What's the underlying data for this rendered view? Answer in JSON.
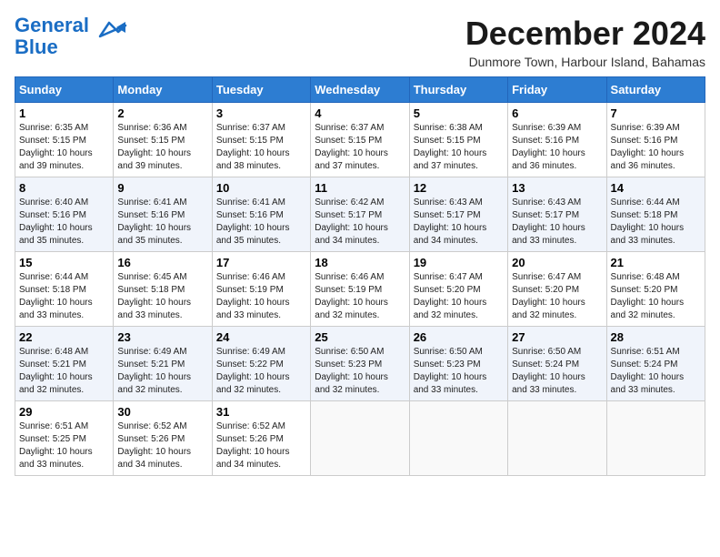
{
  "header": {
    "logo_line1": "General",
    "logo_line2": "Blue",
    "month_title": "December 2024",
    "subtitle": "Dunmore Town, Harbour Island, Bahamas"
  },
  "weekdays": [
    "Sunday",
    "Monday",
    "Tuesday",
    "Wednesday",
    "Thursday",
    "Friday",
    "Saturday"
  ],
  "weeks": [
    [
      {
        "day": "1",
        "sunrise": "6:35 AM",
        "sunset": "5:15 PM",
        "daylight": "10 hours and 39 minutes."
      },
      {
        "day": "2",
        "sunrise": "6:36 AM",
        "sunset": "5:15 PM",
        "daylight": "10 hours and 39 minutes."
      },
      {
        "day": "3",
        "sunrise": "6:37 AM",
        "sunset": "5:15 PM",
        "daylight": "10 hours and 38 minutes."
      },
      {
        "day": "4",
        "sunrise": "6:37 AM",
        "sunset": "5:15 PM",
        "daylight": "10 hours and 37 minutes."
      },
      {
        "day": "5",
        "sunrise": "6:38 AM",
        "sunset": "5:15 PM",
        "daylight": "10 hours and 37 minutes."
      },
      {
        "day": "6",
        "sunrise": "6:39 AM",
        "sunset": "5:16 PM",
        "daylight": "10 hours and 36 minutes."
      },
      {
        "day": "7",
        "sunrise": "6:39 AM",
        "sunset": "5:16 PM",
        "daylight": "10 hours and 36 minutes."
      }
    ],
    [
      {
        "day": "8",
        "sunrise": "6:40 AM",
        "sunset": "5:16 PM",
        "daylight": "10 hours and 35 minutes."
      },
      {
        "day": "9",
        "sunrise": "6:41 AM",
        "sunset": "5:16 PM",
        "daylight": "10 hours and 35 minutes."
      },
      {
        "day": "10",
        "sunrise": "6:41 AM",
        "sunset": "5:16 PM",
        "daylight": "10 hours and 35 minutes."
      },
      {
        "day": "11",
        "sunrise": "6:42 AM",
        "sunset": "5:17 PM",
        "daylight": "10 hours and 34 minutes."
      },
      {
        "day": "12",
        "sunrise": "6:43 AM",
        "sunset": "5:17 PM",
        "daylight": "10 hours and 34 minutes."
      },
      {
        "day": "13",
        "sunrise": "6:43 AM",
        "sunset": "5:17 PM",
        "daylight": "10 hours and 33 minutes."
      },
      {
        "day": "14",
        "sunrise": "6:44 AM",
        "sunset": "5:18 PM",
        "daylight": "10 hours and 33 minutes."
      }
    ],
    [
      {
        "day": "15",
        "sunrise": "6:44 AM",
        "sunset": "5:18 PM",
        "daylight": "10 hours and 33 minutes."
      },
      {
        "day": "16",
        "sunrise": "6:45 AM",
        "sunset": "5:18 PM",
        "daylight": "10 hours and 33 minutes."
      },
      {
        "day": "17",
        "sunrise": "6:46 AM",
        "sunset": "5:19 PM",
        "daylight": "10 hours and 33 minutes."
      },
      {
        "day": "18",
        "sunrise": "6:46 AM",
        "sunset": "5:19 PM",
        "daylight": "10 hours and 32 minutes."
      },
      {
        "day": "19",
        "sunrise": "6:47 AM",
        "sunset": "5:20 PM",
        "daylight": "10 hours and 32 minutes."
      },
      {
        "day": "20",
        "sunrise": "6:47 AM",
        "sunset": "5:20 PM",
        "daylight": "10 hours and 32 minutes."
      },
      {
        "day": "21",
        "sunrise": "6:48 AM",
        "sunset": "5:20 PM",
        "daylight": "10 hours and 32 minutes."
      }
    ],
    [
      {
        "day": "22",
        "sunrise": "6:48 AM",
        "sunset": "5:21 PM",
        "daylight": "10 hours and 32 minutes."
      },
      {
        "day": "23",
        "sunrise": "6:49 AM",
        "sunset": "5:21 PM",
        "daylight": "10 hours and 32 minutes."
      },
      {
        "day": "24",
        "sunrise": "6:49 AM",
        "sunset": "5:22 PM",
        "daylight": "10 hours and 32 minutes."
      },
      {
        "day": "25",
        "sunrise": "6:50 AM",
        "sunset": "5:23 PM",
        "daylight": "10 hours and 32 minutes."
      },
      {
        "day": "26",
        "sunrise": "6:50 AM",
        "sunset": "5:23 PM",
        "daylight": "10 hours and 33 minutes."
      },
      {
        "day": "27",
        "sunrise": "6:50 AM",
        "sunset": "5:24 PM",
        "daylight": "10 hours and 33 minutes."
      },
      {
        "day": "28",
        "sunrise": "6:51 AM",
        "sunset": "5:24 PM",
        "daylight": "10 hours and 33 minutes."
      }
    ],
    [
      {
        "day": "29",
        "sunrise": "6:51 AM",
        "sunset": "5:25 PM",
        "daylight": "10 hours and 33 minutes."
      },
      {
        "day": "30",
        "sunrise": "6:52 AM",
        "sunset": "5:26 PM",
        "daylight": "10 hours and 34 minutes."
      },
      {
        "day": "31",
        "sunrise": "6:52 AM",
        "sunset": "5:26 PM",
        "daylight": "10 hours and 34 minutes."
      },
      null,
      null,
      null,
      null
    ]
  ]
}
